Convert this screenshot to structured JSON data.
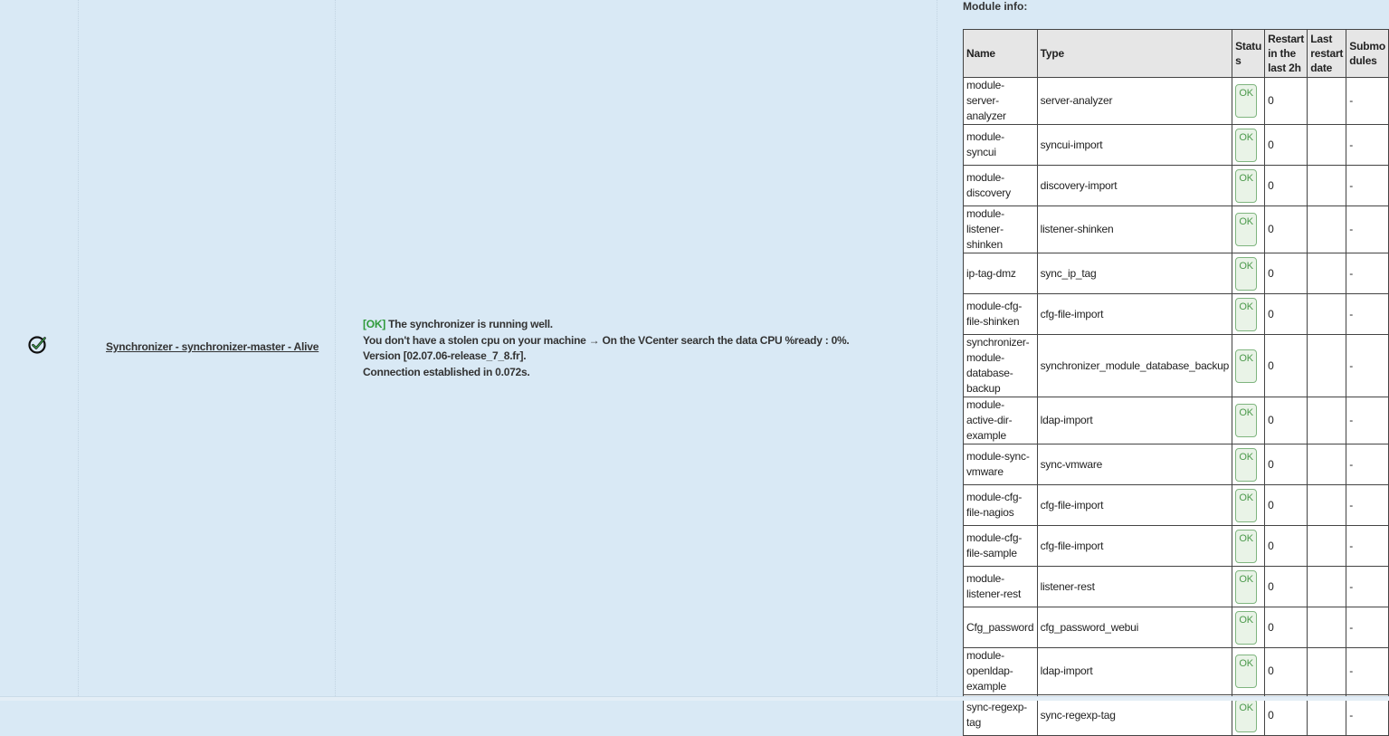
{
  "row": {
    "link_text": "Synchronizer - synchronizer-master - Alive",
    "status_icon": "check-circle-icon",
    "message": {
      "ok_tag": "[OK]",
      "line1": " The synchronizer is running well.",
      "line2": "You don't have a stolen cpu on your machine → On the VCenter search the data CPU %ready :  0%.",
      "line3": "Version [02.07.06-release_7_8.fr].",
      "line4": "Connection established in 0.072s."
    }
  },
  "module_info": {
    "title": "Module info:",
    "headers": {
      "name": "Name",
      "type": "Type",
      "status": "Statu s",
      "restart": "Restart in the last 2h",
      "last_restart": "Last restart date",
      "submodules": "Submo dules"
    },
    "rows": [
      {
        "name": "module-server-analyzer",
        "type": "server-analyzer",
        "status": "OK",
        "restart": "0",
        "last_restart": "",
        "submodules": "-"
      },
      {
        "name": "module-syncui",
        "type": "syncui-import",
        "status": "OK",
        "restart": "0",
        "last_restart": "",
        "submodules": "-"
      },
      {
        "name": "module-discovery",
        "type": "discovery-import",
        "status": "OK",
        "restart": "0",
        "last_restart": "",
        "submodules": "-"
      },
      {
        "name": "module-listener-shinken",
        "type": "listener-shinken",
        "status": "OK",
        "restart": "0",
        "last_restart": "",
        "submodules": "-"
      },
      {
        "name": "ip-tag-dmz",
        "type": "sync_ip_tag",
        "status": "OK",
        "restart": "0",
        "last_restart": "",
        "submodules": "-"
      },
      {
        "name": "module-cfg-file-shinken",
        "type": "cfg-file-import",
        "status": "OK",
        "restart": "0",
        "last_restart": "",
        "submodules": "-"
      },
      {
        "name": "synchronizer-module-database-backup",
        "type": "synchronizer_module_database_backup",
        "status": "OK",
        "restart": "0",
        "last_restart": "",
        "submodules": "-"
      },
      {
        "name": "module-active-dir-example",
        "type": "ldap-import",
        "status": "OK",
        "restart": "0",
        "last_restart": "",
        "submodules": "-"
      },
      {
        "name": "module-sync-vmware",
        "type": "sync-vmware",
        "status": "OK",
        "restart": "0",
        "last_restart": "",
        "submodules": "-"
      },
      {
        "name": "module-cfg-file-nagios",
        "type": "cfg-file-import",
        "status": "OK",
        "restart": "0",
        "last_restart": "",
        "submodules": "-"
      },
      {
        "name": "module-cfg-file-sample",
        "type": "cfg-file-import",
        "status": "OK",
        "restart": "0",
        "last_restart": "",
        "submodules": "-"
      },
      {
        "name": "module-listener-rest",
        "type": "listener-rest",
        "status": "OK",
        "restart": "0",
        "last_restart": "",
        "submodules": "-"
      },
      {
        "name": "Cfg_password",
        "type": "cfg_password_webui",
        "status": "OK",
        "restart": "0",
        "last_restart": "",
        "submodules": "-"
      },
      {
        "name": "module-openldap-example",
        "type": "ldap-import",
        "status": "OK",
        "restart": "0",
        "last_restart": "",
        "submodules": "-"
      },
      {
        "name": "sync-regexp-tag",
        "type": "sync-regexp-tag",
        "status": "OK",
        "restart": "0",
        "last_restart": "",
        "submodules": "-"
      }
    ]
  }
}
